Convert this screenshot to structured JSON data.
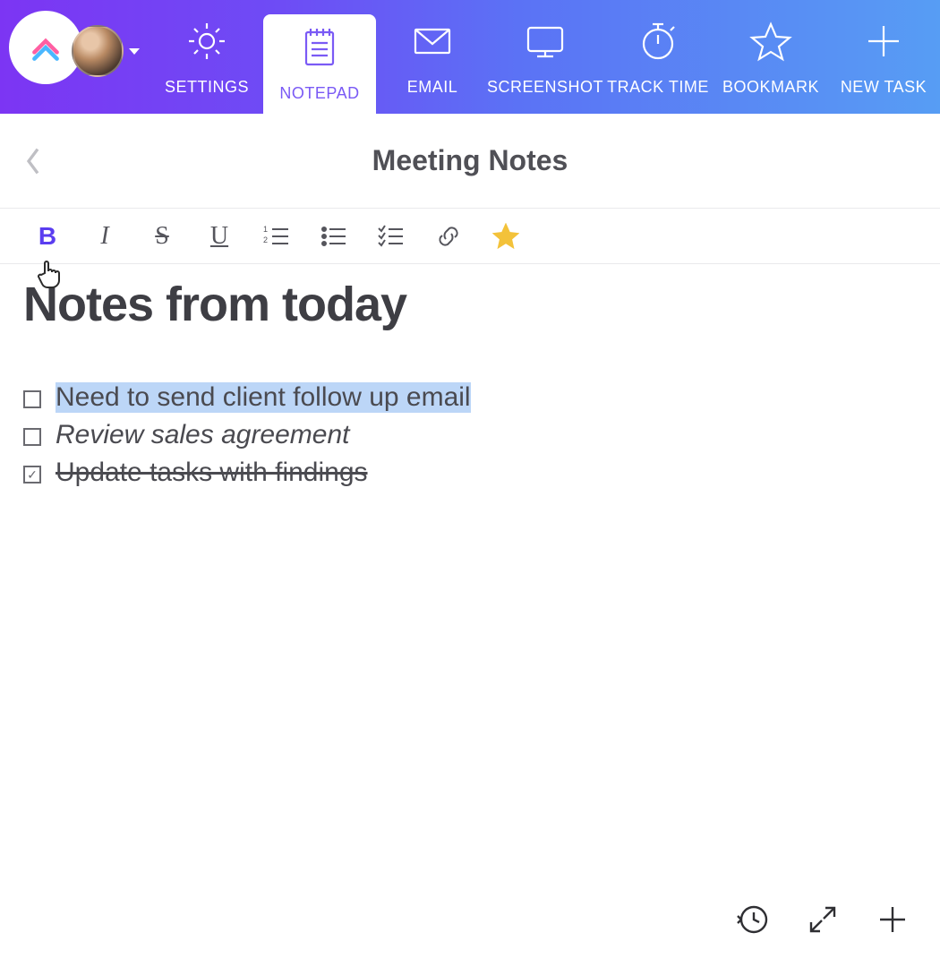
{
  "nav": {
    "tabs": [
      {
        "label": "SETTINGS",
        "icon": "gear-icon"
      },
      {
        "label": "NOTEPAD",
        "icon": "notepad-icon",
        "active": true
      },
      {
        "label": "EMAIL",
        "icon": "email-icon"
      },
      {
        "label": "SCREENSHOT",
        "icon": "screenshot-icon"
      },
      {
        "label": "TRACK TIME",
        "icon": "stopwatch-icon"
      },
      {
        "label": "BOOKMARK",
        "icon": "star-icon"
      },
      {
        "label": "NEW TASK",
        "icon": "plus-icon"
      }
    ]
  },
  "title": "Meeting Notes",
  "toolbar": {
    "bold_active": true,
    "star_active": true,
    "items": [
      "bold",
      "italic",
      "strikethrough",
      "underline",
      "ordered-list",
      "unordered-list",
      "checklist",
      "link",
      "favorite"
    ]
  },
  "document": {
    "heading": "Notes from today",
    "lines": [
      {
        "text": "Need to send client follow up email",
        "checked": false,
        "selected": true
      },
      {
        "text": "Review sales agreement",
        "checked": false,
        "italic": true
      },
      {
        "text": "Update tasks with findings",
        "checked": true,
        "strike": true
      }
    ]
  },
  "bottom_actions": [
    "history",
    "expand",
    "add"
  ]
}
